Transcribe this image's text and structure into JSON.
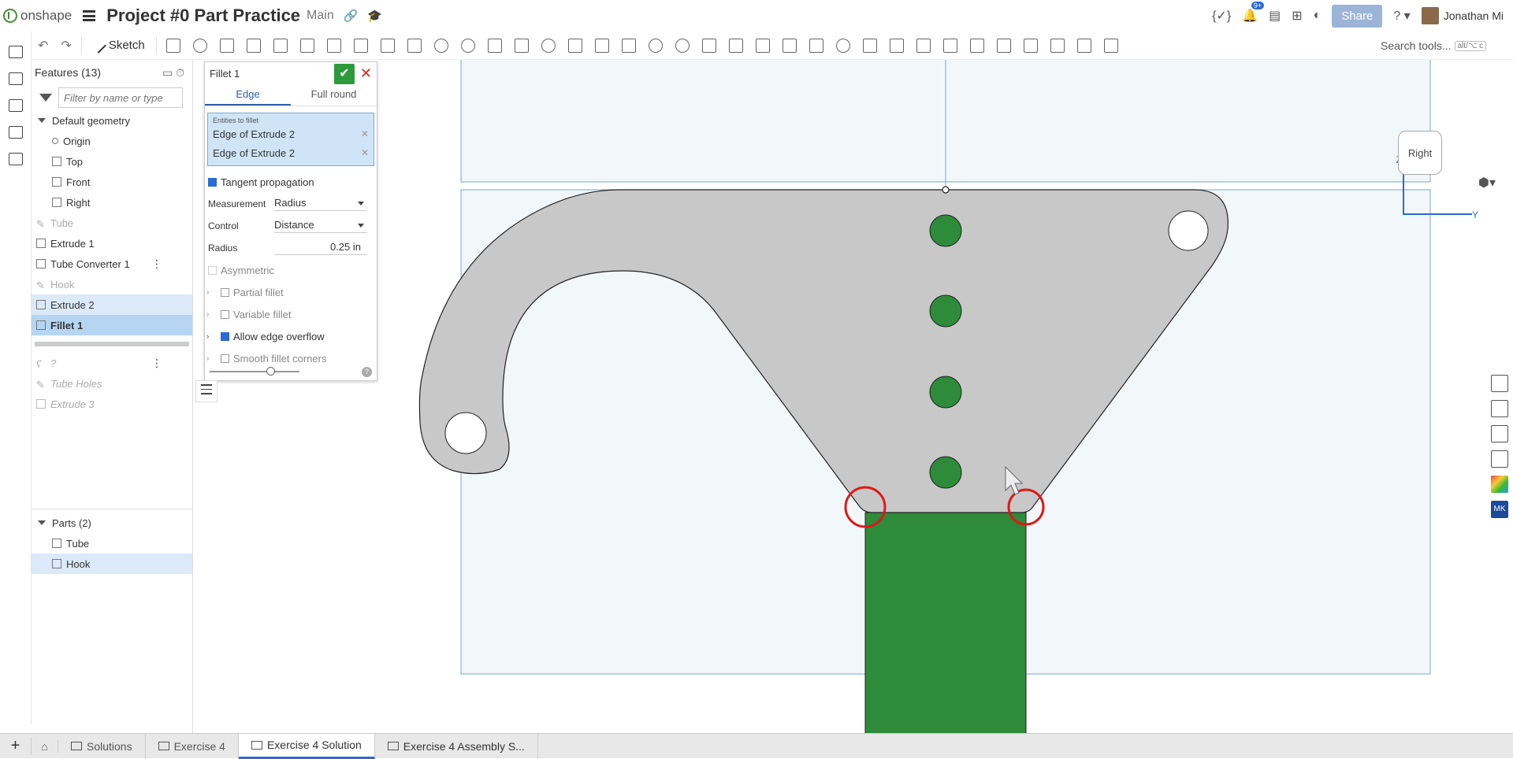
{
  "app": {
    "logo_text": "onshape",
    "document_title": "Project #0 Part Practice",
    "branch": "Main"
  },
  "topbar": {
    "notifications_badge": "9+",
    "share_label": "Share",
    "help_label": "?",
    "user_name": "Jonathan Mi"
  },
  "toolbar": {
    "sketch_label": "Sketch",
    "search_label": "Search tools...",
    "search_shortcut": "alt/⌥ c"
  },
  "features": {
    "header": "Features (13)",
    "filter_placeholder": "Filter by name or type",
    "default_geometry_label": "Default geometry",
    "default_geometry": [
      "Origin",
      "Top",
      "Front",
      "Right"
    ],
    "items": [
      {
        "label": "Tube",
        "state": "suppressed"
      },
      {
        "label": "Extrude 1",
        "state": "normal"
      },
      {
        "label": "Tube Converter 1",
        "state": "normal"
      },
      {
        "label": "Hook",
        "state": "suppressed"
      },
      {
        "label": "Extrude 2",
        "state": "selected"
      },
      {
        "label": "Fillet 1",
        "state": "editing"
      }
    ],
    "rolled_back": [
      "?",
      "Tube Holes",
      "Extrude 3"
    ],
    "parts_header": "Parts (2)",
    "parts": [
      "Tube",
      "Hook"
    ]
  },
  "fillet_dialog": {
    "title": "Fillet 1",
    "ok_icon": "✔",
    "cancel_icon": "✕",
    "tabs": [
      "Edge",
      "Full round"
    ],
    "entities_label": "Entities to fillet",
    "entities": [
      "Edge of Extrude 2",
      "Edge of Extrude 2"
    ],
    "tangent_propagation": "Tangent propagation",
    "measurement_label": "Measurement",
    "measurement_value": "Radius",
    "control_label": "Control",
    "control_value": "Distance",
    "radius_label": "Radius",
    "radius_value": "0.25 in",
    "asymmetric": "Asymmetric",
    "partial_fillet": "Partial fillet",
    "variable_fillet": "Variable fillet",
    "allow_edge_overflow": "Allow edge overflow",
    "smooth_fillet_corners": "Smooth fillet corners",
    "help": "?"
  },
  "viewcube": {
    "face": "Right",
    "axis_z": "Z",
    "axis_y": "Y"
  },
  "bottom_tabs": {
    "add": "+",
    "tabs": [
      {
        "label": "Solutions",
        "active": false
      },
      {
        "label": "Exercise 4",
        "active": false
      },
      {
        "label": "Exercise 4 Solution",
        "active": true
      },
      {
        "label": "Exercise 4 Assembly S...",
        "active": false
      }
    ]
  },
  "colors": {
    "part_grey": "#c8c8c8",
    "highlight_green": "#2e8b3a",
    "selection_red": "#e01818",
    "accent_blue": "#2a6ad4"
  }
}
